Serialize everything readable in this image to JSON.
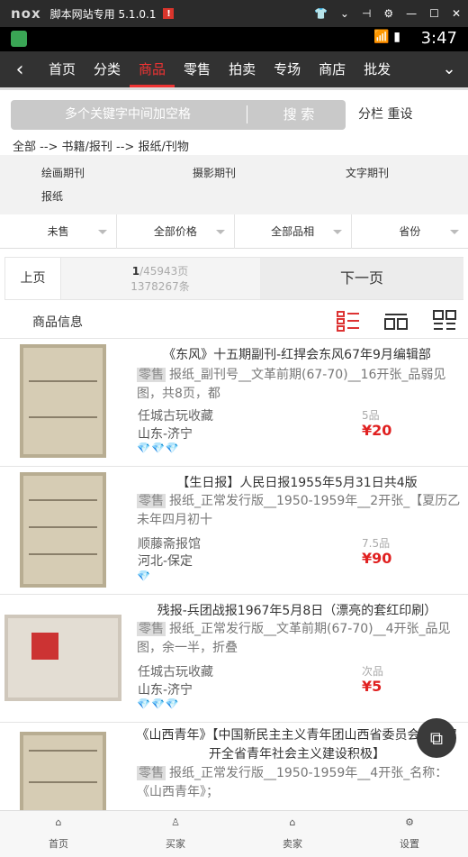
{
  "emulator": {
    "logo": "nox",
    "title": "脚本网站专用 5.1.0.1",
    "badge": "!"
  },
  "status": {
    "time": "3:47"
  },
  "nav": {
    "tabs": [
      "首页",
      "分类",
      "商品",
      "零售",
      "拍卖",
      "专场",
      "商店",
      "批发"
    ],
    "active_index": 2
  },
  "search": {
    "placeholder": "多个关键字中间加空格",
    "button": "搜 索",
    "actions": "分栏 重设"
  },
  "breadcrumb": "全部 --> 书籍/报刊 --> 报纸/刊物",
  "categories": [
    "绘画期刊",
    "摄影期刊",
    "文字期刊",
    "报纸"
  ],
  "filters": [
    "未售",
    "全部价格",
    "全部品相",
    "省份"
  ],
  "pager": {
    "prev": "上页",
    "current_page": "1",
    "total_pages": "/45943页",
    "total_items": "1378267条",
    "next": "下一页"
  },
  "list_header": {
    "label": "商品信息"
  },
  "items": [
    {
      "title": "《东风》十五期副刊-红捍会东风67年9月编辑部",
      "tag": "零售",
      "desc": "报纸_副刊号__文革前期(67-70)__16开张_品弱见图，共8页，都",
      "shop": "任城古玩收藏",
      "location": "山东-济宁",
      "gems": "💎💎💎",
      "condition": "5品",
      "price": "¥20"
    },
    {
      "title": "【生日报】人民日报1955年5月31日共4版",
      "tag": "零售",
      "desc": "报纸_正常发行版__1950-1959年__2开张_【夏历乙未年四月初十",
      "shop": "顺藤斋报馆",
      "location": "河北-保定",
      "gems": "💎",
      "condition": "7.5品",
      "price": "¥90"
    },
    {
      "title": "残报-兵团战报1967年5月8日（漂亮的套红印刷）",
      "tag": "零售",
      "desc": "报纸_正常发行版__文革前期(67-70)__4开张_品见图，余一半，折叠",
      "shop": "任城古玩收藏",
      "location": "山东-济宁",
      "gems": "💎💎💎",
      "condition": "次品",
      "price": "¥5"
    },
    {
      "title": "《山西青年》【中国新民主主义青年团山西省委员会关于召开全省青年社会主义建设积极】",
      "tag": "零售",
      "desc": "报纸_正常发行版__1950-1959年__4开张_名称：《山西青年》；",
      "shop": "",
      "location": "",
      "gems": "",
      "condition": "",
      "price": ""
    }
  ],
  "bottom_nav": [
    "首页",
    "买家",
    "卖家",
    "设置"
  ]
}
